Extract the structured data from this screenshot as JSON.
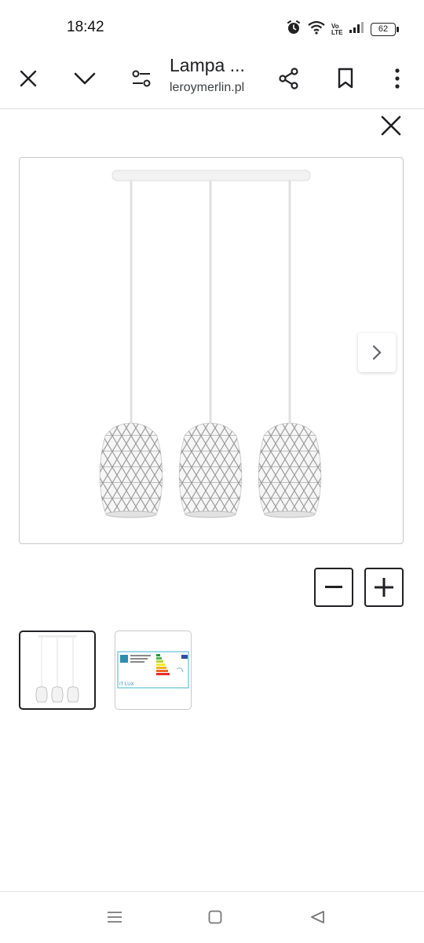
{
  "status_bar": {
    "time": "18:42",
    "network_label": "Vo LTE",
    "battery": "62",
    "icons": [
      "alarm-icon",
      "wifi-icon",
      "signal-icon",
      "battery-icon"
    ]
  },
  "toolbar": {
    "title": "Lampa ...",
    "domain": "leroymerlin.pl",
    "icons": [
      "close-icon",
      "chevron-down-icon",
      "page-settings-icon",
      "share-icon",
      "bookmark-icon",
      "more-vert-icon"
    ]
  },
  "viewer": {
    "close_icon": "close-icon",
    "next_icon": "chevron-right-icon",
    "zoom_out_icon": "minus-icon",
    "zoom_in_icon": "plus-icon",
    "thumbnails": [
      {
        "type": "product-photo",
        "selected": true
      },
      {
        "type": "energy-label",
        "selected": false,
        "brand": "IT LUX"
      }
    ]
  },
  "nav_bar": {
    "icons": [
      "recents-icon",
      "home-icon",
      "back-icon"
    ]
  },
  "colors": {
    "ink": "#202124",
    "border": "#c8c8c8",
    "divider": "#dadce0",
    "lamp_white": "#f4f4f4"
  }
}
